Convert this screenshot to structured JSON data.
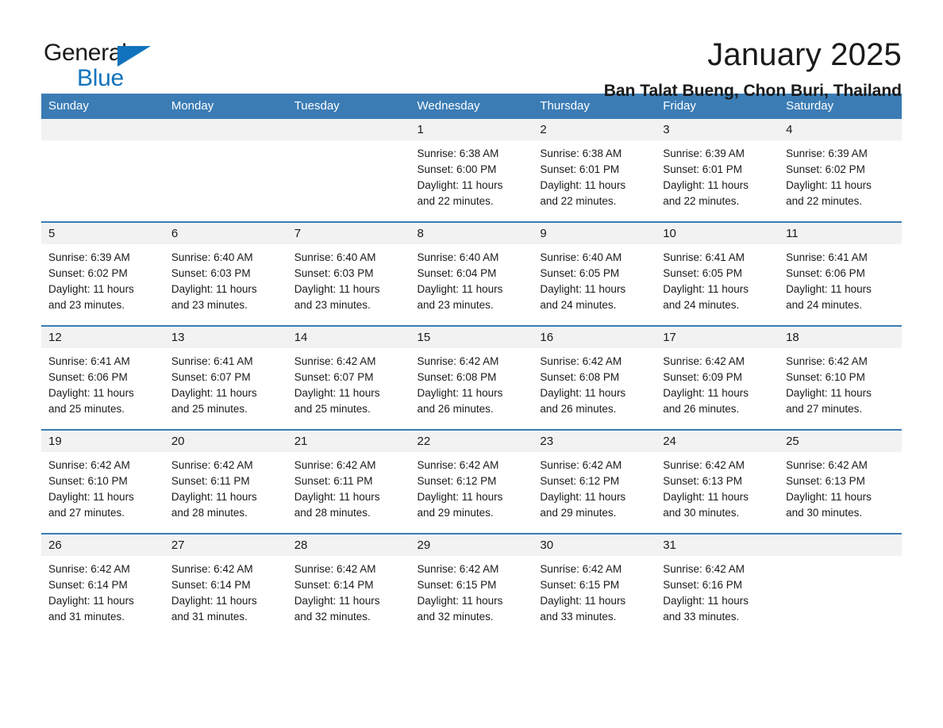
{
  "brand": {
    "name_part1": "General",
    "name_part2": "Blue"
  },
  "header": {
    "title": "January 2025",
    "subtitle": "Ban Talat Bueng, Chon Buri, Thailand"
  },
  "colors": {
    "header_blue": "#3b7cb5",
    "logo_blue": "#1173bd",
    "daynum_band": "#f2f2f2",
    "text": "#1a1a1a"
  },
  "weekday_headers": [
    "Sunday",
    "Monday",
    "Tuesday",
    "Wednesday",
    "Thursday",
    "Friday",
    "Saturday"
  ],
  "weeks": [
    [
      {
        "day": "",
        "sunrise": "",
        "sunset": "",
        "daylight_1": "",
        "daylight_2": ""
      },
      {
        "day": "",
        "sunrise": "",
        "sunset": "",
        "daylight_1": "",
        "daylight_2": ""
      },
      {
        "day": "",
        "sunrise": "",
        "sunset": "",
        "daylight_1": "",
        "daylight_2": ""
      },
      {
        "day": "1",
        "sunrise": "Sunrise: 6:38 AM",
        "sunset": "Sunset: 6:00 PM",
        "daylight_1": "Daylight: 11 hours",
        "daylight_2": "and 22 minutes."
      },
      {
        "day": "2",
        "sunrise": "Sunrise: 6:38 AM",
        "sunset": "Sunset: 6:01 PM",
        "daylight_1": "Daylight: 11 hours",
        "daylight_2": "and 22 minutes."
      },
      {
        "day": "3",
        "sunrise": "Sunrise: 6:39 AM",
        "sunset": "Sunset: 6:01 PM",
        "daylight_1": "Daylight: 11 hours",
        "daylight_2": "and 22 minutes."
      },
      {
        "day": "4",
        "sunrise": "Sunrise: 6:39 AM",
        "sunset": "Sunset: 6:02 PM",
        "daylight_1": "Daylight: 11 hours",
        "daylight_2": "and 22 minutes."
      }
    ],
    [
      {
        "day": "5",
        "sunrise": "Sunrise: 6:39 AM",
        "sunset": "Sunset: 6:02 PM",
        "daylight_1": "Daylight: 11 hours",
        "daylight_2": "and 23 minutes."
      },
      {
        "day": "6",
        "sunrise": "Sunrise: 6:40 AM",
        "sunset": "Sunset: 6:03 PM",
        "daylight_1": "Daylight: 11 hours",
        "daylight_2": "and 23 minutes."
      },
      {
        "day": "7",
        "sunrise": "Sunrise: 6:40 AM",
        "sunset": "Sunset: 6:03 PM",
        "daylight_1": "Daylight: 11 hours",
        "daylight_2": "and 23 minutes."
      },
      {
        "day": "8",
        "sunrise": "Sunrise: 6:40 AM",
        "sunset": "Sunset: 6:04 PM",
        "daylight_1": "Daylight: 11 hours",
        "daylight_2": "and 23 minutes."
      },
      {
        "day": "9",
        "sunrise": "Sunrise: 6:40 AM",
        "sunset": "Sunset: 6:05 PM",
        "daylight_1": "Daylight: 11 hours",
        "daylight_2": "and 24 minutes."
      },
      {
        "day": "10",
        "sunrise": "Sunrise: 6:41 AM",
        "sunset": "Sunset: 6:05 PM",
        "daylight_1": "Daylight: 11 hours",
        "daylight_2": "and 24 minutes."
      },
      {
        "day": "11",
        "sunrise": "Sunrise: 6:41 AM",
        "sunset": "Sunset: 6:06 PM",
        "daylight_1": "Daylight: 11 hours",
        "daylight_2": "and 24 minutes."
      }
    ],
    [
      {
        "day": "12",
        "sunrise": "Sunrise: 6:41 AM",
        "sunset": "Sunset: 6:06 PM",
        "daylight_1": "Daylight: 11 hours",
        "daylight_2": "and 25 minutes."
      },
      {
        "day": "13",
        "sunrise": "Sunrise: 6:41 AM",
        "sunset": "Sunset: 6:07 PM",
        "daylight_1": "Daylight: 11 hours",
        "daylight_2": "and 25 minutes."
      },
      {
        "day": "14",
        "sunrise": "Sunrise: 6:42 AM",
        "sunset": "Sunset: 6:07 PM",
        "daylight_1": "Daylight: 11 hours",
        "daylight_2": "and 25 minutes."
      },
      {
        "day": "15",
        "sunrise": "Sunrise: 6:42 AM",
        "sunset": "Sunset: 6:08 PM",
        "daylight_1": "Daylight: 11 hours",
        "daylight_2": "and 26 minutes."
      },
      {
        "day": "16",
        "sunrise": "Sunrise: 6:42 AM",
        "sunset": "Sunset: 6:08 PM",
        "daylight_1": "Daylight: 11 hours",
        "daylight_2": "and 26 minutes."
      },
      {
        "day": "17",
        "sunrise": "Sunrise: 6:42 AM",
        "sunset": "Sunset: 6:09 PM",
        "daylight_1": "Daylight: 11 hours",
        "daylight_2": "and 26 minutes."
      },
      {
        "day": "18",
        "sunrise": "Sunrise: 6:42 AM",
        "sunset": "Sunset: 6:10 PM",
        "daylight_1": "Daylight: 11 hours",
        "daylight_2": "and 27 minutes."
      }
    ],
    [
      {
        "day": "19",
        "sunrise": "Sunrise: 6:42 AM",
        "sunset": "Sunset: 6:10 PM",
        "daylight_1": "Daylight: 11 hours",
        "daylight_2": "and 27 minutes."
      },
      {
        "day": "20",
        "sunrise": "Sunrise: 6:42 AM",
        "sunset": "Sunset: 6:11 PM",
        "daylight_1": "Daylight: 11 hours",
        "daylight_2": "and 28 minutes."
      },
      {
        "day": "21",
        "sunrise": "Sunrise: 6:42 AM",
        "sunset": "Sunset: 6:11 PM",
        "daylight_1": "Daylight: 11 hours",
        "daylight_2": "and 28 minutes."
      },
      {
        "day": "22",
        "sunrise": "Sunrise: 6:42 AM",
        "sunset": "Sunset: 6:12 PM",
        "daylight_1": "Daylight: 11 hours",
        "daylight_2": "and 29 minutes."
      },
      {
        "day": "23",
        "sunrise": "Sunrise: 6:42 AM",
        "sunset": "Sunset: 6:12 PM",
        "daylight_1": "Daylight: 11 hours",
        "daylight_2": "and 29 minutes."
      },
      {
        "day": "24",
        "sunrise": "Sunrise: 6:42 AM",
        "sunset": "Sunset: 6:13 PM",
        "daylight_1": "Daylight: 11 hours",
        "daylight_2": "and 30 minutes."
      },
      {
        "day": "25",
        "sunrise": "Sunrise: 6:42 AM",
        "sunset": "Sunset: 6:13 PM",
        "daylight_1": "Daylight: 11 hours",
        "daylight_2": "and 30 minutes."
      }
    ],
    [
      {
        "day": "26",
        "sunrise": "Sunrise: 6:42 AM",
        "sunset": "Sunset: 6:14 PM",
        "daylight_1": "Daylight: 11 hours",
        "daylight_2": "and 31 minutes."
      },
      {
        "day": "27",
        "sunrise": "Sunrise: 6:42 AM",
        "sunset": "Sunset: 6:14 PM",
        "daylight_1": "Daylight: 11 hours",
        "daylight_2": "and 31 minutes."
      },
      {
        "day": "28",
        "sunrise": "Sunrise: 6:42 AM",
        "sunset": "Sunset: 6:14 PM",
        "daylight_1": "Daylight: 11 hours",
        "daylight_2": "and 32 minutes."
      },
      {
        "day": "29",
        "sunrise": "Sunrise: 6:42 AM",
        "sunset": "Sunset: 6:15 PM",
        "daylight_1": "Daylight: 11 hours",
        "daylight_2": "and 32 minutes."
      },
      {
        "day": "30",
        "sunrise": "Sunrise: 6:42 AM",
        "sunset": "Sunset: 6:15 PM",
        "daylight_1": "Daylight: 11 hours",
        "daylight_2": "and 33 minutes."
      },
      {
        "day": "31",
        "sunrise": "Sunrise: 6:42 AM",
        "sunset": "Sunset: 6:16 PM",
        "daylight_1": "Daylight: 11 hours",
        "daylight_2": "and 33 minutes."
      },
      {
        "day": "",
        "sunrise": "",
        "sunset": "",
        "daylight_1": "",
        "daylight_2": ""
      }
    ]
  ]
}
